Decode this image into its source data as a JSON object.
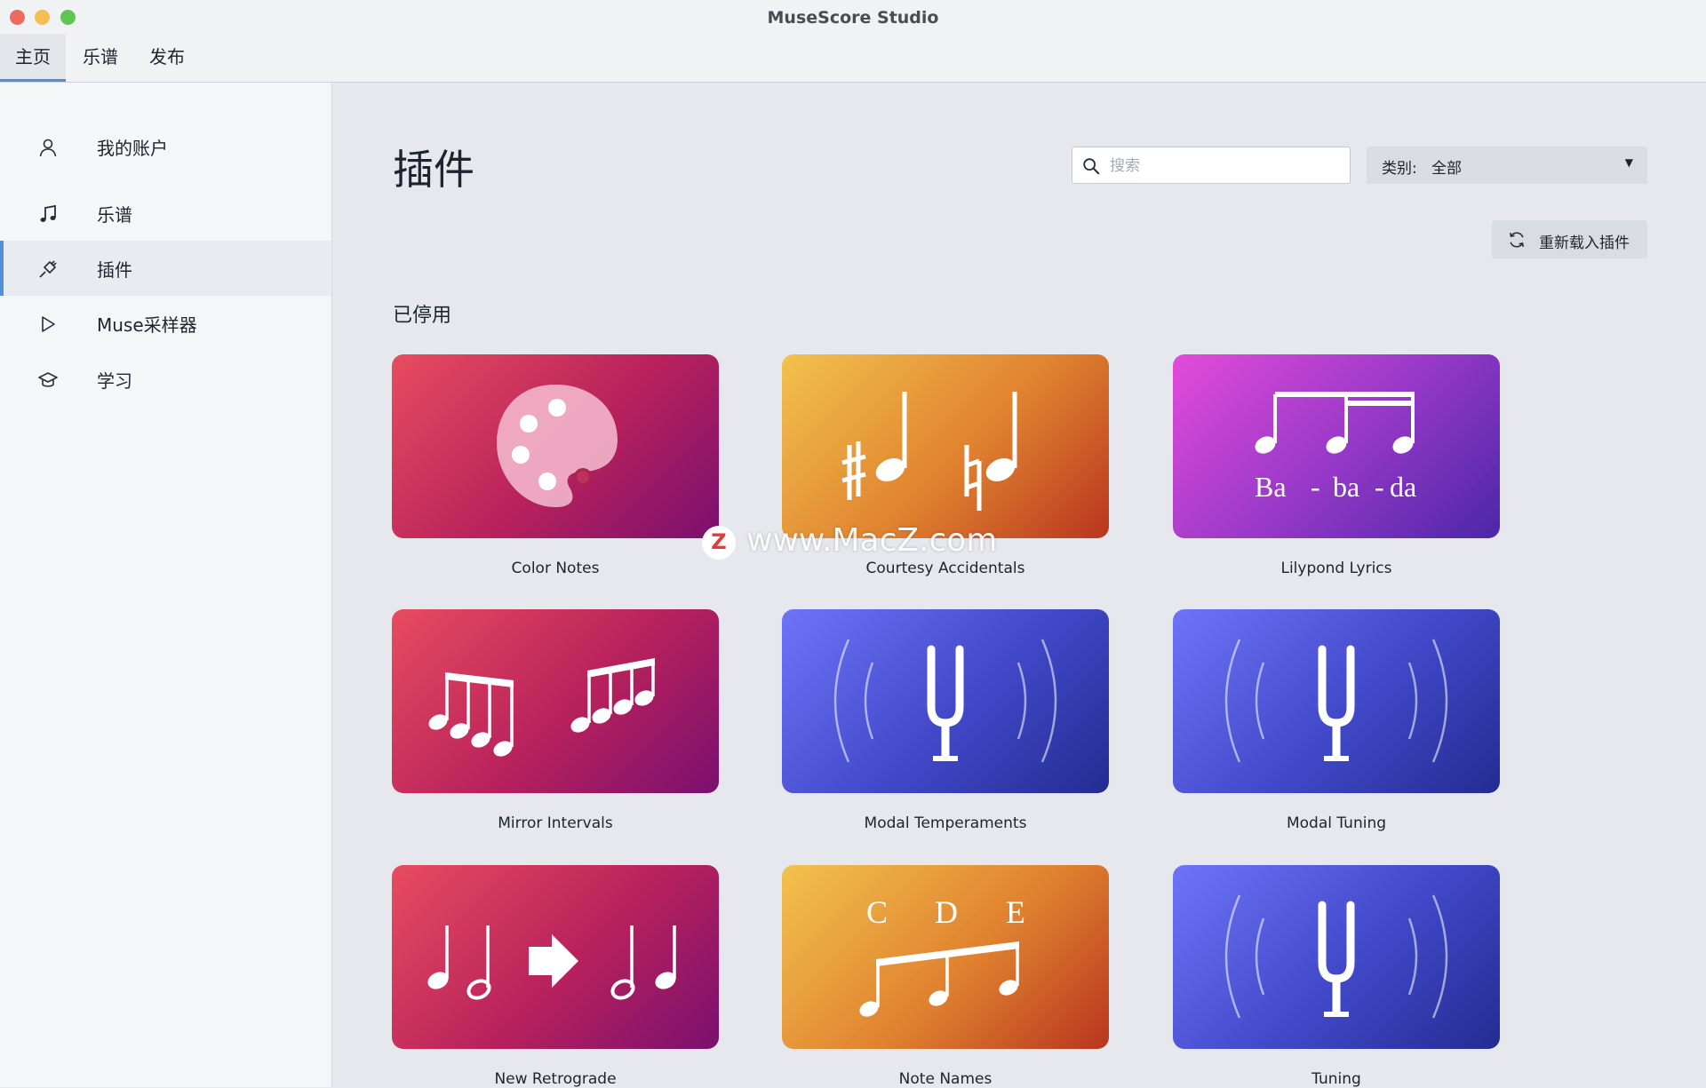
{
  "window": {
    "title": "MuseScore Studio"
  },
  "tabs": [
    {
      "label": "主页"
    },
    {
      "label": "乐谱"
    },
    {
      "label": "发布"
    }
  ],
  "sidebar": {
    "items": [
      {
        "label": "我的账户",
        "icon": "user-icon"
      },
      {
        "label": "乐谱",
        "icon": "music-note-icon"
      },
      {
        "label": "插件",
        "icon": "plugin-icon",
        "active": true
      },
      {
        "label": "Muse采样器",
        "icon": "play-icon"
      },
      {
        "label": "学习",
        "icon": "graduation-cap-icon"
      }
    ]
  },
  "main": {
    "title": "插件",
    "search": {
      "placeholder": "搜索",
      "value": ""
    },
    "category": {
      "label": "类别:",
      "value": "全部"
    },
    "reload_label": "重新载入插件",
    "section_title": "已停用",
    "plugins": [
      {
        "name": "Color Notes",
        "theme": "red"
      },
      {
        "name": "Courtesy Accidentals",
        "theme": "orange"
      },
      {
        "name": "Lilypond Lyrics",
        "theme": "purple",
        "art_text": [
          "Ba",
          "-",
          "ba",
          "-",
          "da"
        ]
      },
      {
        "name": "Mirror Intervals",
        "theme": "red"
      },
      {
        "name": "Modal Temperaments",
        "theme": "blue"
      },
      {
        "name": "Modal Tuning",
        "theme": "blue"
      },
      {
        "name": "New Retrograde",
        "theme": "red"
      },
      {
        "name": "Note Names",
        "theme": "orange",
        "art_text": [
          "C",
          "D",
          "E"
        ]
      },
      {
        "name": "Tuning",
        "theme": "blue"
      }
    ]
  },
  "watermark": {
    "badge": "Z",
    "text": "www.MacZ.com"
  },
  "colors": {
    "accent": "#4f8fd7",
    "red_card": "#c42a5c",
    "orange_card": "#e0822f",
    "purple_card": "#9a39c9",
    "blue_card": "#4048c8"
  }
}
